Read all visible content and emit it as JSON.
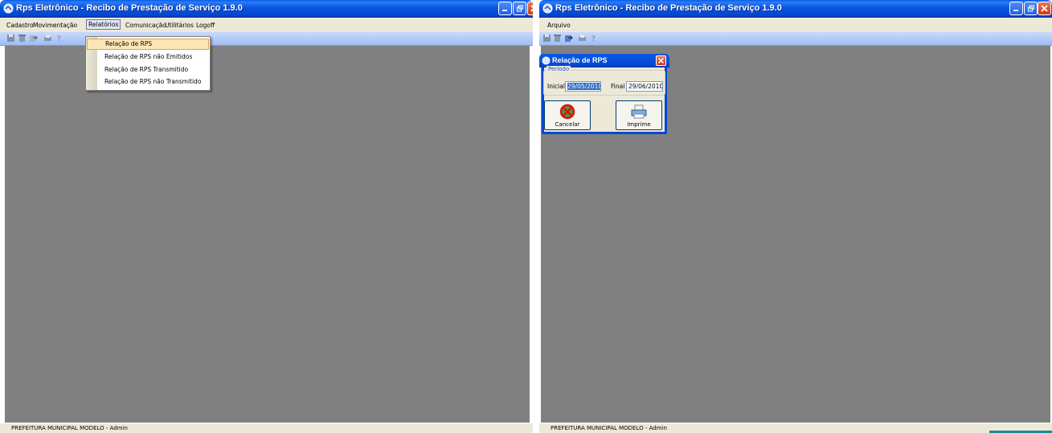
{
  "left": {
    "title": "Rps Eletrônico - Recibo de Prestação de Serviço 1.9.0",
    "menu": [
      "Cadastro",
      "Movimentação",
      "Relatórios",
      "Comunicação",
      "Utilitários",
      "Logoff"
    ],
    "active_menu": "Relatórios",
    "dropdown": [
      "Relação de RPS",
      "Relação de RPS não Emitidos",
      "Relação de RPS Transmitido",
      "Relação de RPS não Transmitido"
    ],
    "status": "PREFEITURA MUNICIPAL MODELO - Admin"
  },
  "right": {
    "title": "Rps Eletrônico - Recibo de Prestação de Serviço 1.9.0",
    "menu": [
      "Arquivo"
    ],
    "status": "PREFEITURA MUNICIPAL MODELO - Admin",
    "dialog": {
      "title": "Relação de RPS",
      "group_label": "Período",
      "inicial_label": "Inicial",
      "inicial_value": "29/05/2010",
      "final_label": "Final",
      "final_value": "29/06/2010",
      "cancel_label": "Cancelar",
      "print_label": "Imprime"
    }
  },
  "icons": {
    "toolbar": [
      "save-icon",
      "delete-icon",
      "export-icon",
      "print-icon",
      "help-icon"
    ],
    "window_buttons": [
      "minimize-icon",
      "restore-icon",
      "close-icon"
    ]
  },
  "colors": {
    "titlebar": "#0455DF",
    "workarea": "#808080",
    "menu_bg": "#ECE9D8",
    "highlight": "#FDE6B6"
  }
}
